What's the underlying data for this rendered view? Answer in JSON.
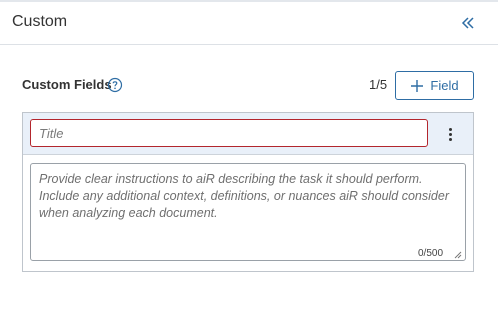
{
  "panel": {
    "title": "Custom",
    "collapse_icon": "double-chevron-left-icon"
  },
  "custom_fields": {
    "label": "Custom Fields",
    "help_icon": "question-circle-icon",
    "count": "1/5",
    "add_button_label": "Field",
    "add_button_icon": "plus-icon"
  },
  "field": {
    "title_placeholder": "Title",
    "title_value": "",
    "description_placeholder": "Provide clear instructions to aiR describing the task it should perform. Include any additional context, definitions, or nuances aiR should consider when analyzing each document.",
    "description_value": "",
    "char_count": "0/500",
    "menu_icon": "kebab-menu-icon"
  },
  "colors": {
    "accent": "#2e6da4",
    "error_border": "#b3262d",
    "card_header_bg": "#e9f0f9"
  }
}
